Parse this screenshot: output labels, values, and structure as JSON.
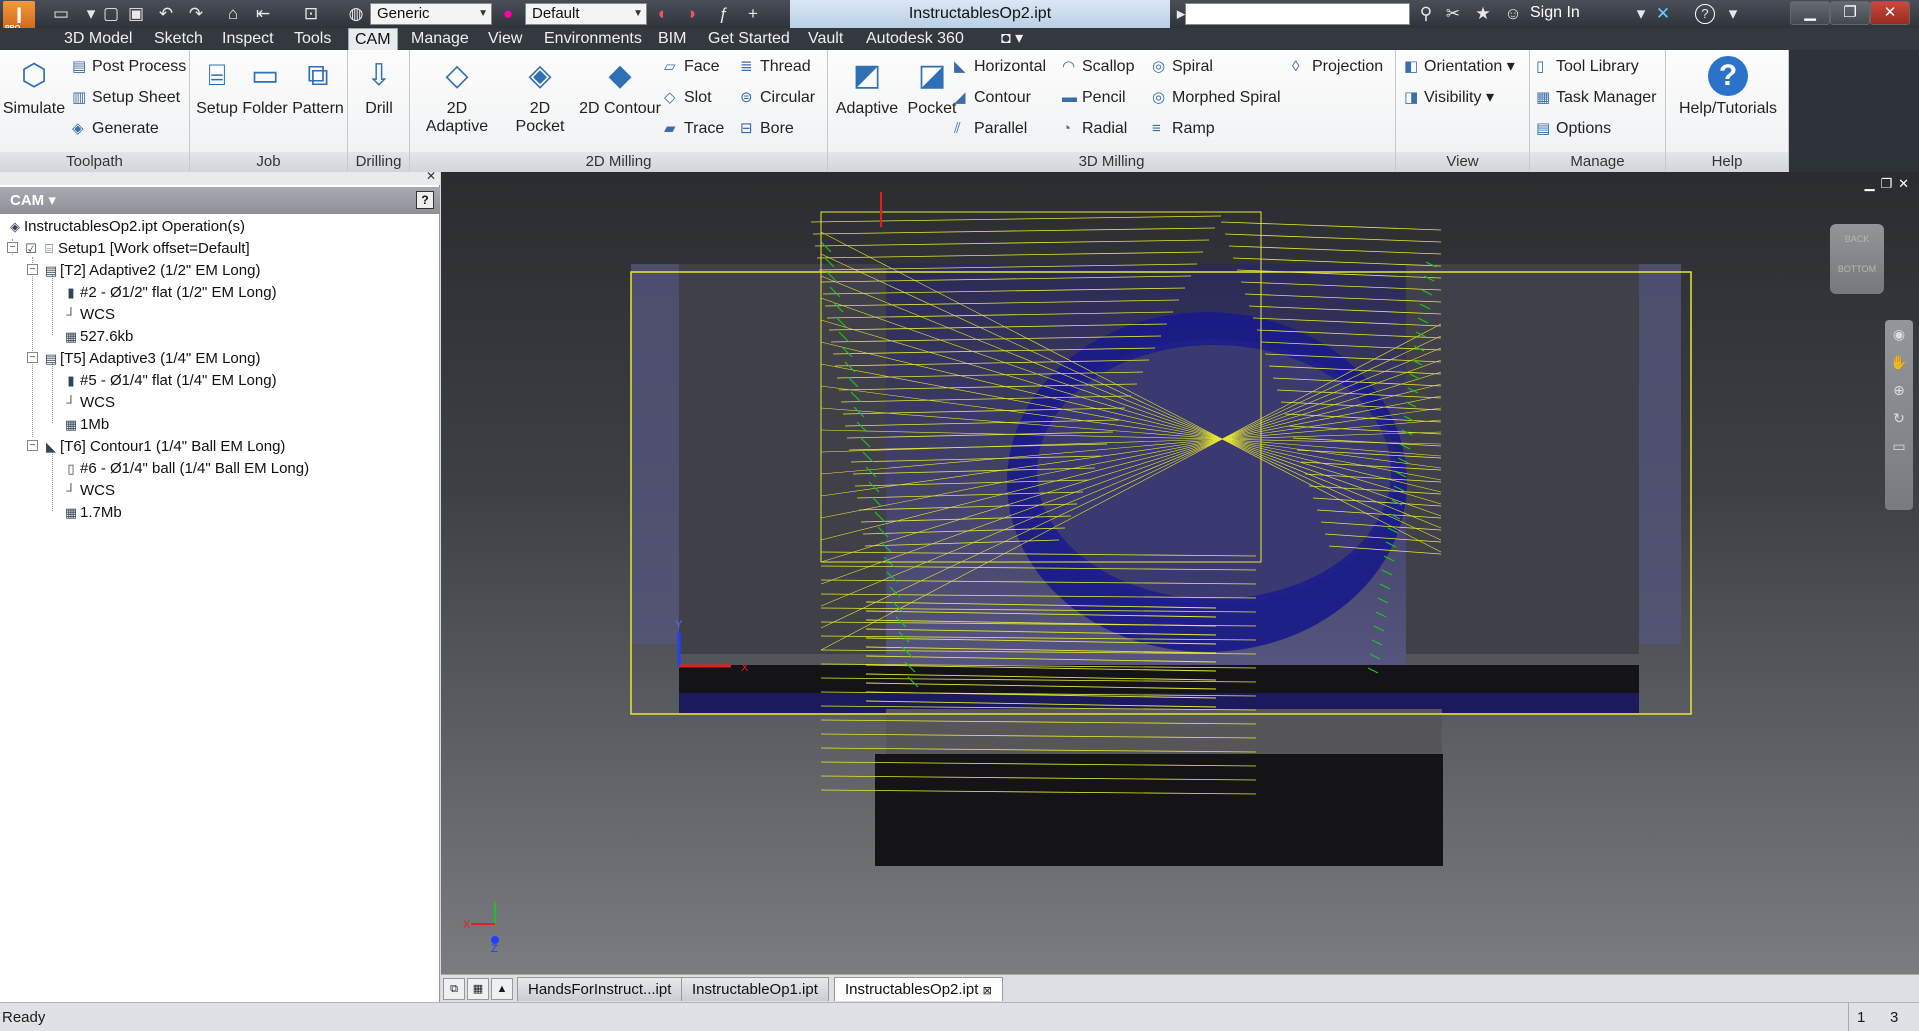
{
  "app": {
    "title": "InstructablesOp2.ipt",
    "logo_badge": "PRO",
    "material_combo": "Generic",
    "appearance_combo": "Default",
    "sign_in": "Sign In",
    "help_glyph": "?"
  },
  "menu_tabs": [
    "3D Model",
    "Sketch",
    "Inspect",
    "Tools",
    "CAM",
    "Manage",
    "View",
    "Environments",
    "BIM",
    "Get Started",
    "Vault",
    "Autodesk 360"
  ],
  "active_tab": "CAM",
  "ribbon": {
    "toolpath": {
      "label": "Toolpath",
      "simulate": "Simulate",
      "post_process": "Post Process",
      "setup_sheet": "Setup Sheet",
      "generate": "Generate"
    },
    "job": {
      "label": "Job",
      "setup": "Setup",
      "folder": "Folder",
      "pattern": "Pattern"
    },
    "drilling": {
      "label": "Drilling",
      "drill": "Drill"
    },
    "milling2d": {
      "label": "2D Milling",
      "adaptive2d": "2D Adaptive",
      "pocket2d": "2D Pocket",
      "contour2d": "2D Contour",
      "face": "Face",
      "slot": "Slot",
      "trace": "Trace",
      "thread": "Thread",
      "circular": "Circular",
      "bore": "Bore"
    },
    "milling3d": {
      "label": "3D Milling",
      "adaptive": "Adaptive",
      "pocket": "Pocket",
      "horizontal": "Horizontal",
      "contour": "Contour",
      "parallel": "Parallel",
      "scallop": "Scallop",
      "pencil": "Pencil",
      "radial": "Radial",
      "spiral": "Spiral",
      "morphed_spiral": "Morphed Spiral",
      "ramp": "Ramp",
      "projection": "Projection"
    },
    "view": {
      "label": "View",
      "orientation": "Orientation",
      "visibility": "Visibility"
    },
    "manage": {
      "label": "Manage",
      "tool_library": "Tool Library",
      "task_manager": "Task Manager",
      "options": "Options"
    },
    "help": {
      "label": "Help",
      "help_tutorials": "Help/Tutorials"
    }
  },
  "browser": {
    "header": "CAM",
    "root": "InstructablesOp2.ipt Operation(s)",
    "setup": "Setup1 [Work offset=Default]",
    "op1": "[T2] Adaptive2 (1/2\" EM Long)",
    "op1_tool": "#2 - Ø1/2\" flat (1/2\" EM Long)",
    "op1_wcs": "WCS",
    "op1_size": "527.6kb",
    "op2": "[T5] Adaptive3 (1/4\" EM Long)",
    "op2_tool": "#5 - Ø1/4\" flat (1/4\" EM Long)",
    "op2_wcs": "WCS",
    "op2_size": "1Mb",
    "op3": "[T6] Contour1 (1/4\" Ball EM Long)",
    "op3_tool": "#6 - Ø1/4\" ball (1/4\" Ball EM Long)",
    "op3_wcs": "WCS",
    "op3_size": "1.7Mb"
  },
  "viewcube": {
    "back": "BACK",
    "bottom": "BOTTOM"
  },
  "axis_labels": {
    "x": "X",
    "y": "Y",
    "z": "Z"
  },
  "doc_tabs": [
    "HandsForInstruct...ipt",
    "InstructableOp1.ipt",
    "InstructablesOp2.ipt"
  ],
  "active_doc_tab": 2,
  "status": {
    "text": "Ready",
    "count1": "1",
    "count2": "3"
  },
  "colors": {
    "toolpath_yellow": "#e8e830",
    "toolpath_blue": "#1a1ad8",
    "toolpath_green": "#20c020",
    "accent_orange": "#e07a20"
  }
}
